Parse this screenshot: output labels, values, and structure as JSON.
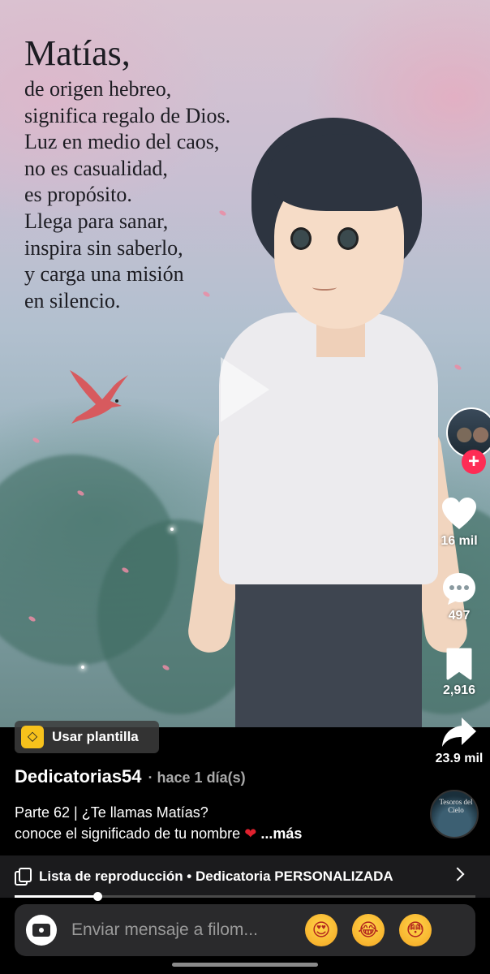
{
  "video": {
    "poem_title": "Matías,",
    "poem_lines": [
      "de origen hebreo,",
      "significa regalo de Dios.",
      "Luz en medio del caos,",
      "no es casualidad,",
      "es propósito.",
      "Llega para sanar,",
      "inspira sin saberlo,",
      "y carga una misión",
      "en silencio."
    ]
  },
  "rail": {
    "like_count": "16 mil",
    "comment_count": "497",
    "save_count": "2,916",
    "share_count": "23.9 mil",
    "follow_symbol": "+"
  },
  "template": {
    "icon": "◇",
    "label": "Usar plantilla"
  },
  "post": {
    "author": "Dedicatorias54",
    "time": "· hace 1 día(s)",
    "caption_line1": "Parte 62 | ¿Te llamas Matías?",
    "caption_line2": "conoce el significado de tu nombre",
    "caption_emoji": "❤",
    "more_label": "...más"
  },
  "music": {
    "disc_text": "Tesoros del Cielo"
  },
  "playlist": {
    "label": "Lista de reproducción • Dedicatoria PERSONALIZADA"
  },
  "progress": {
    "fraction": 0.18
  },
  "composer": {
    "placeholder": "Enviar mensaje a filom...",
    "emojis": [
      "😍",
      "😂",
      "😳"
    ]
  },
  "colors": {
    "accent": "#fe2c55",
    "template_yellow": "#f7c21c"
  }
}
